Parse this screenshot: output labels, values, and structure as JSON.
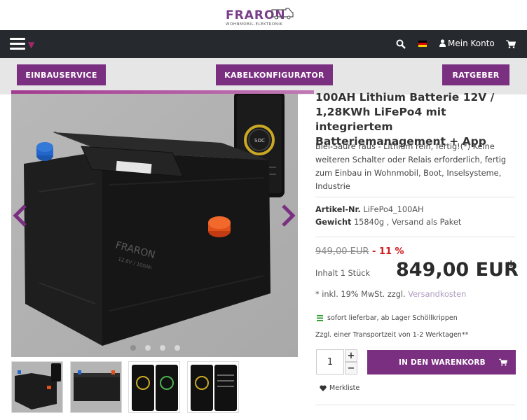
{
  "brand": {
    "logo_text": "FRARON",
    "logo_sub": "WOHNMOBIL-ELEKTRONIK"
  },
  "nav": {
    "account_label": "Mein Konto",
    "icons": [
      "menu-icon",
      "chevron-down-icon",
      "search-icon",
      "flag-de-icon",
      "user-icon",
      "cart-icon"
    ]
  },
  "buttons": {
    "einbauservice": "EINBAUSERVICE",
    "kabelkonfigurator": "KABELKONFIGURATOR",
    "ratgeber": "RATGEBER"
  },
  "gallery": {
    "images": [
      {
        "label": "image-1",
        "active": true
      },
      {
        "label": "image-2",
        "active": false
      },
      {
        "label": "image-3",
        "active": false
      },
      {
        "label": "image-4",
        "active": false
      }
    ]
  },
  "product": {
    "title": "100AH Lithium Batterie 12V / 1,28KWh LiFePo4 mit integriertem Batteriemanagement + App",
    "description": "Blei-Säure raus - Lithium rein, fertig!(*) Keine weiteren Schalter oder Relais erforderlich, fertig zum Einbau in Wohnmobil, Boot, Inselsysteme, Industrie",
    "article_label": "Artikel-Nr.",
    "article_value": "LiFePo4_100AH",
    "weight_label": "Gewicht",
    "weight_value": "15840g , Versand als Paket",
    "old_price": "949,00 EUR",
    "discount": "- 11 %",
    "content": "Inhalt 1 Stück",
    "price": "849,00 EUR",
    "price_star": "*",
    "vat_text": "* inkl. 19% MwSt. zzgl.",
    "vat_link": "Versandkosten",
    "availability": "sofort lieferbar, ab Lager Schöllkrippen",
    "transport": "Zzgl. einer Transportzeit von 1-2 Werktagen**",
    "quantity": "1",
    "add_to_cart": "IN DEN WARENKORB",
    "wishlist": "Merkliste"
  },
  "colors": {
    "brand_purple": "#7a2f80",
    "nav_dark": "#26292d",
    "discount_red": "#d11a1a",
    "stock_green": "#3aa03a"
  }
}
